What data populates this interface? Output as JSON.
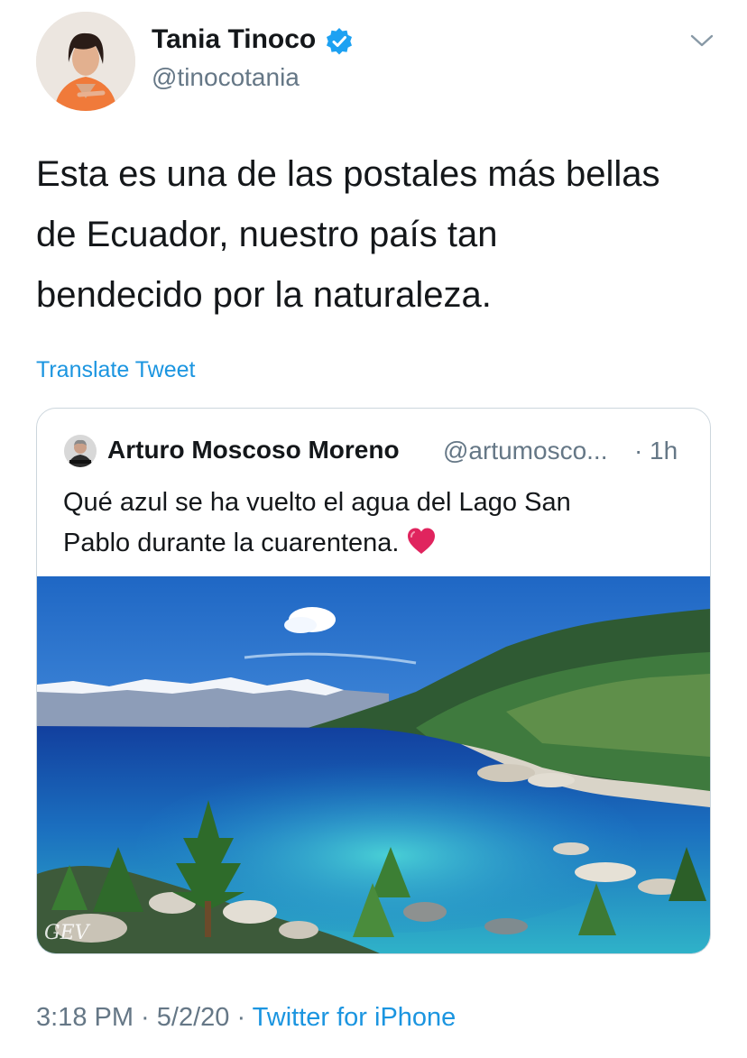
{
  "tweet": {
    "author": {
      "name": "Tania Tinoco",
      "handle": "@tinocotania",
      "verified": true
    },
    "text_lines": [
      "Esta es una de las postales más bellas",
      "de Ecuador, nuestro país tan",
      "bendecido por la naturaleza."
    ],
    "translate_label": "Translate Tweet",
    "timestamp": "3:18 PM · 5/2/20",
    "separator": " · ",
    "source": "Twitter for iPhone"
  },
  "quoted": {
    "author_name": "Arturo Moscoso Moreno",
    "handle": "@artumosco...",
    "dot": "·",
    "time": "1h",
    "text_lines": [
      "Qué azul se ha vuelto el agua del Lago San",
      "Pablo durante la cuarentena."
    ],
    "emoji": "red-heart",
    "image_watermark": "GEV"
  },
  "colors": {
    "text": "#14171a",
    "secondary": "#657786",
    "link": "#1b95e0",
    "verified": "#1da1f2",
    "border": "#ccd6dd",
    "heart": "#e0245e"
  },
  "icons": [
    "verified-badge-icon",
    "chevron-down-icon",
    "red-heart-emoji"
  ]
}
